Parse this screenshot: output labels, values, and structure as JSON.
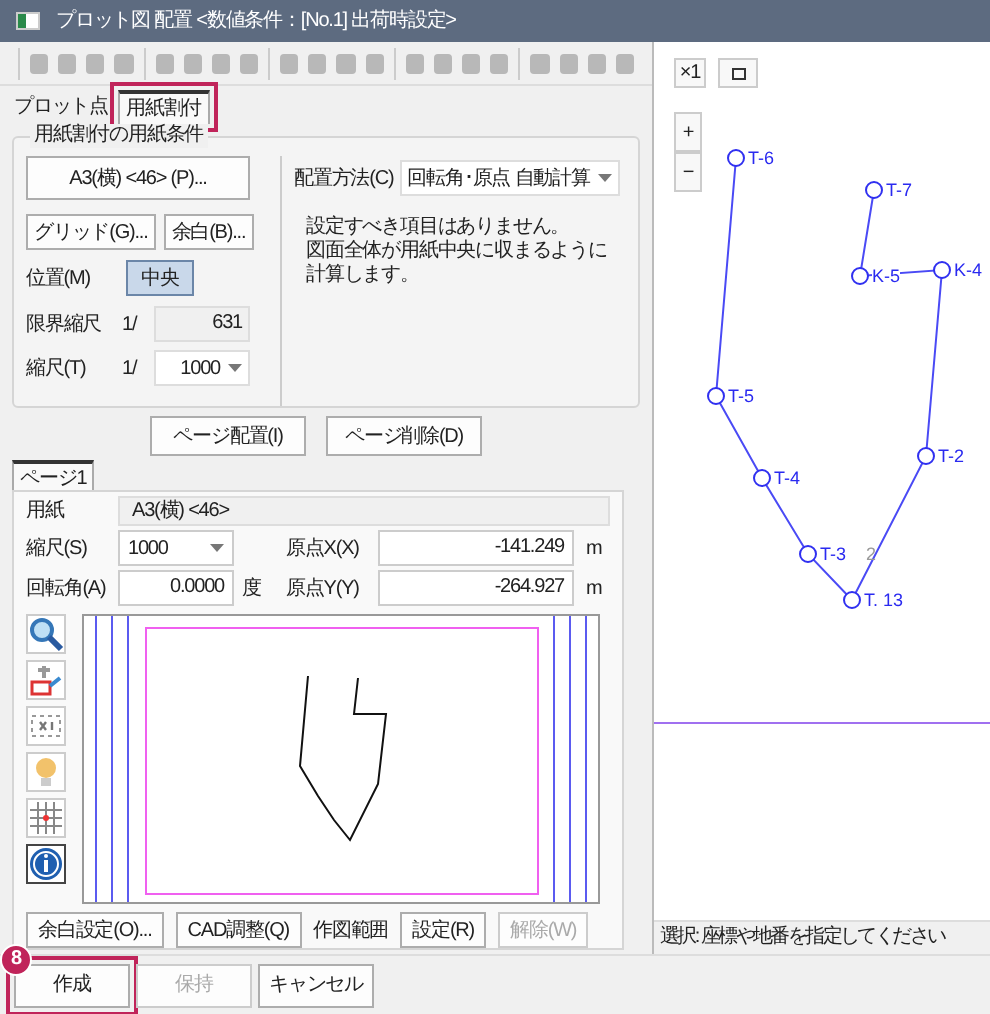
{
  "window": {
    "title": "プロット図 配置 <数値条件：[No.1] 出荷時設定>"
  },
  "tabs": [
    {
      "label": "プロット点",
      "selected": false,
      "highlighted": false
    },
    {
      "label": "用紙割付",
      "selected": true,
      "highlighted": true
    }
  ],
  "paper_conditions": {
    "legend": "用紙割付の用紙条件",
    "paper_button": "A3(横) <46> (P)...",
    "grid_button": "グリッド(G)...",
    "margin_button": "余白(B)...",
    "position_label": "位置(M)",
    "position_value": "中央",
    "limit_label": "限界縮尺",
    "limit_prefix": "1/",
    "limit_value": "631",
    "scale_label": "縮尺(T)",
    "scale_prefix": "1/",
    "scale_value": "1000",
    "method_label": "配置方法(C)",
    "method_value": "回転角･原点 自動計算",
    "message_lines": [
      "設定すべき項目はありません。",
      "図面全体が用紙中央に収まるように",
      "計算します。"
    ]
  },
  "page_buttons": [
    "ページ配置(I)",
    "ページ削除(D)"
  ],
  "page_tabs": [
    {
      "label": "ページ1",
      "selected": true
    }
  ],
  "page": {
    "paper_label": "用紙",
    "paper_value": "A3(横) <46>",
    "scale_label": "縮尺(S)",
    "scale_value": "1000",
    "rotation_label": "回転角(A)",
    "rotation_value": "0.0000",
    "rotation_unit": "度",
    "origin_x_label": "原点X(X)",
    "origin_x_value": "-141.249",
    "origin_x_unit": "m",
    "origin_y_label": "原点Y(Y)",
    "origin_y_value": "-264.927",
    "origin_y_unit": "m"
  },
  "page_actions": [
    {
      "kind": "button",
      "label": "余白設定(O)...",
      "disabled": false
    },
    {
      "kind": "button",
      "label": "CAD調整(Q)",
      "disabled": false
    },
    {
      "kind": "label",
      "label": "作図範囲"
    },
    {
      "kind": "button",
      "label": "設定(R)",
      "disabled": false
    },
    {
      "kind": "button",
      "label": "解除(W)",
      "disabled": true
    }
  ],
  "footer_buttons": [
    {
      "label": "作成",
      "disabled": false,
      "highlighted": true,
      "badge": "8"
    },
    {
      "label": "保持",
      "disabled": true,
      "highlighted": false
    },
    {
      "label": "キャンセル",
      "disabled": false,
      "highlighted": false
    }
  ],
  "map": {
    "scale_button": "×1",
    "zoom_in": "+",
    "zoom_out": "−",
    "points": [
      {
        "label": "T-6"
      },
      {
        "label": "T-7"
      },
      {
        "label": "K-5"
      },
      {
        "label": "K-4"
      },
      {
        "label": "T-5"
      },
      {
        "label": "T-2"
      },
      {
        "label": "T-4"
      },
      {
        "label": "T-3",
        "suffix": "2"
      },
      {
        "label": "T. 13"
      }
    ]
  },
  "status_bar": "選択: 座標や地番を指定してください"
}
